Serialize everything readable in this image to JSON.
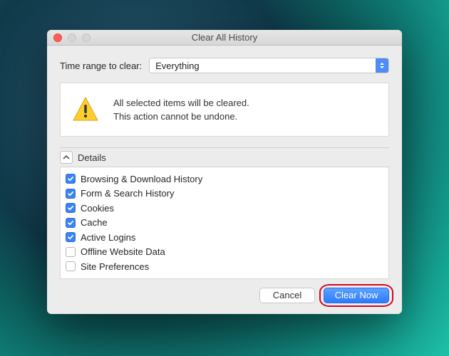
{
  "window": {
    "title": "Clear All History"
  },
  "range": {
    "label": "Time range to clear:",
    "value": "Everything"
  },
  "warning": {
    "line1": "All selected items will be cleared.",
    "line2": "This action cannot be undone."
  },
  "details": {
    "label": "Details"
  },
  "items": [
    {
      "label": "Browsing & Download History",
      "checked": true
    },
    {
      "label": "Form & Search History",
      "checked": true
    },
    {
      "label": "Cookies",
      "checked": true
    },
    {
      "label": "Cache",
      "checked": true
    },
    {
      "label": "Active Logins",
      "checked": true
    },
    {
      "label": "Offline Website Data",
      "checked": false
    },
    {
      "label": "Site Preferences",
      "checked": false
    }
  ],
  "buttons": {
    "cancel": "Cancel",
    "clear": "Clear Now"
  }
}
